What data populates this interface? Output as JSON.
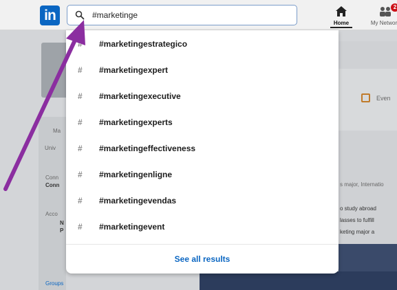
{
  "app": {
    "logo_text": "in",
    "brand_color": "#0a66c2"
  },
  "search": {
    "value": "#marketinge",
    "icon": "search-icon"
  },
  "nav": {
    "home_label": "Home",
    "network_label": "My Network",
    "network_badge": "2"
  },
  "background": {
    "texts": {
      "left1": "Ma",
      "left2": "Univ",
      "left3": "Conn",
      "left4": "Conn",
      "left5": "Acco",
      "left6": "N",
      "left7": "P",
      "left8": "Groups",
      "right_events": "Even",
      "right1": "s major, Internatio",
      "right2": "o study abroad",
      "right3": "lasses to fulfill",
      "right4": "keting major a"
    }
  },
  "dropdown": {
    "suggestions": [
      {
        "icon": "#",
        "text": "#marketingestrategico"
      },
      {
        "icon": "#",
        "text": "#marketingexpert"
      },
      {
        "icon": "#",
        "text": "#marketingexecutive"
      },
      {
        "icon": "#",
        "text": "#marketingexperts"
      },
      {
        "icon": "#",
        "text": "#marketingeffectiveness"
      },
      {
        "icon": "#",
        "text": "#marketingenligne"
      },
      {
        "icon": "#",
        "text": "#marketingevendas"
      },
      {
        "icon": "#",
        "text": "#marketingevent"
      }
    ],
    "see_all_label": "See all results"
  },
  "annotation": {
    "arrow_color": "#8b2ea0"
  }
}
